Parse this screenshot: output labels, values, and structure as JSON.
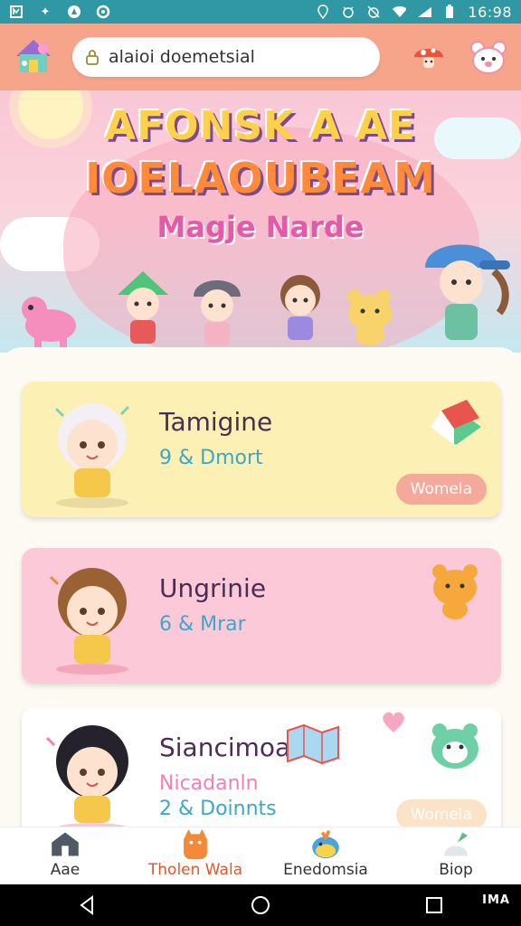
{
  "status_bar": {
    "time": "16:98",
    "left_icons": [
      "photo-icon",
      "bolt-icon",
      "compass-icon",
      "sync-icon"
    ],
    "right_icons": [
      "location-icon",
      "vibrate-icon",
      "alarm-off-icon",
      "wifi-icon",
      "signal-icon",
      "battery-icon"
    ]
  },
  "app_bar": {
    "search_text": "alaioi doemetsial",
    "actions": [
      "mushroom-icon",
      "bear-face-icon"
    ]
  },
  "hero": {
    "title_line1": "AFONSK A AE",
    "title_line2": "IOELAOUBEAM",
    "subtitle": "Magje Narde"
  },
  "cards": [
    {
      "title": "Tamigine",
      "subtitle": "9 & Dmort",
      "action": "Womela",
      "bg": "#fdf0b5",
      "sub_color": "#3ba8c7",
      "action_color": "#f4a99a"
    },
    {
      "title": "Ungrinie",
      "subtitle": "6 & Mrar",
      "bg": "#fbc9d7",
      "sub_color": "#3ba8c7"
    },
    {
      "title": "Siancimoa",
      "subtitle": "Nicadanln",
      "meta": "2 & Doinnts",
      "action": "Womela",
      "bg": "#ffffff",
      "sub_color": "#ee82b6",
      "action_color": "#fbe3c8"
    }
  ],
  "bottom_nav": [
    {
      "label": "Aae",
      "icon": "house-icon"
    },
    {
      "label": "Tholen Wala",
      "icon": "cat-icon",
      "active": true
    },
    {
      "label": "Enedomsia",
      "icon": "bird-icon"
    },
    {
      "label": "Biop",
      "icon": "bag-icon"
    }
  ],
  "watermark": "IMA"
}
